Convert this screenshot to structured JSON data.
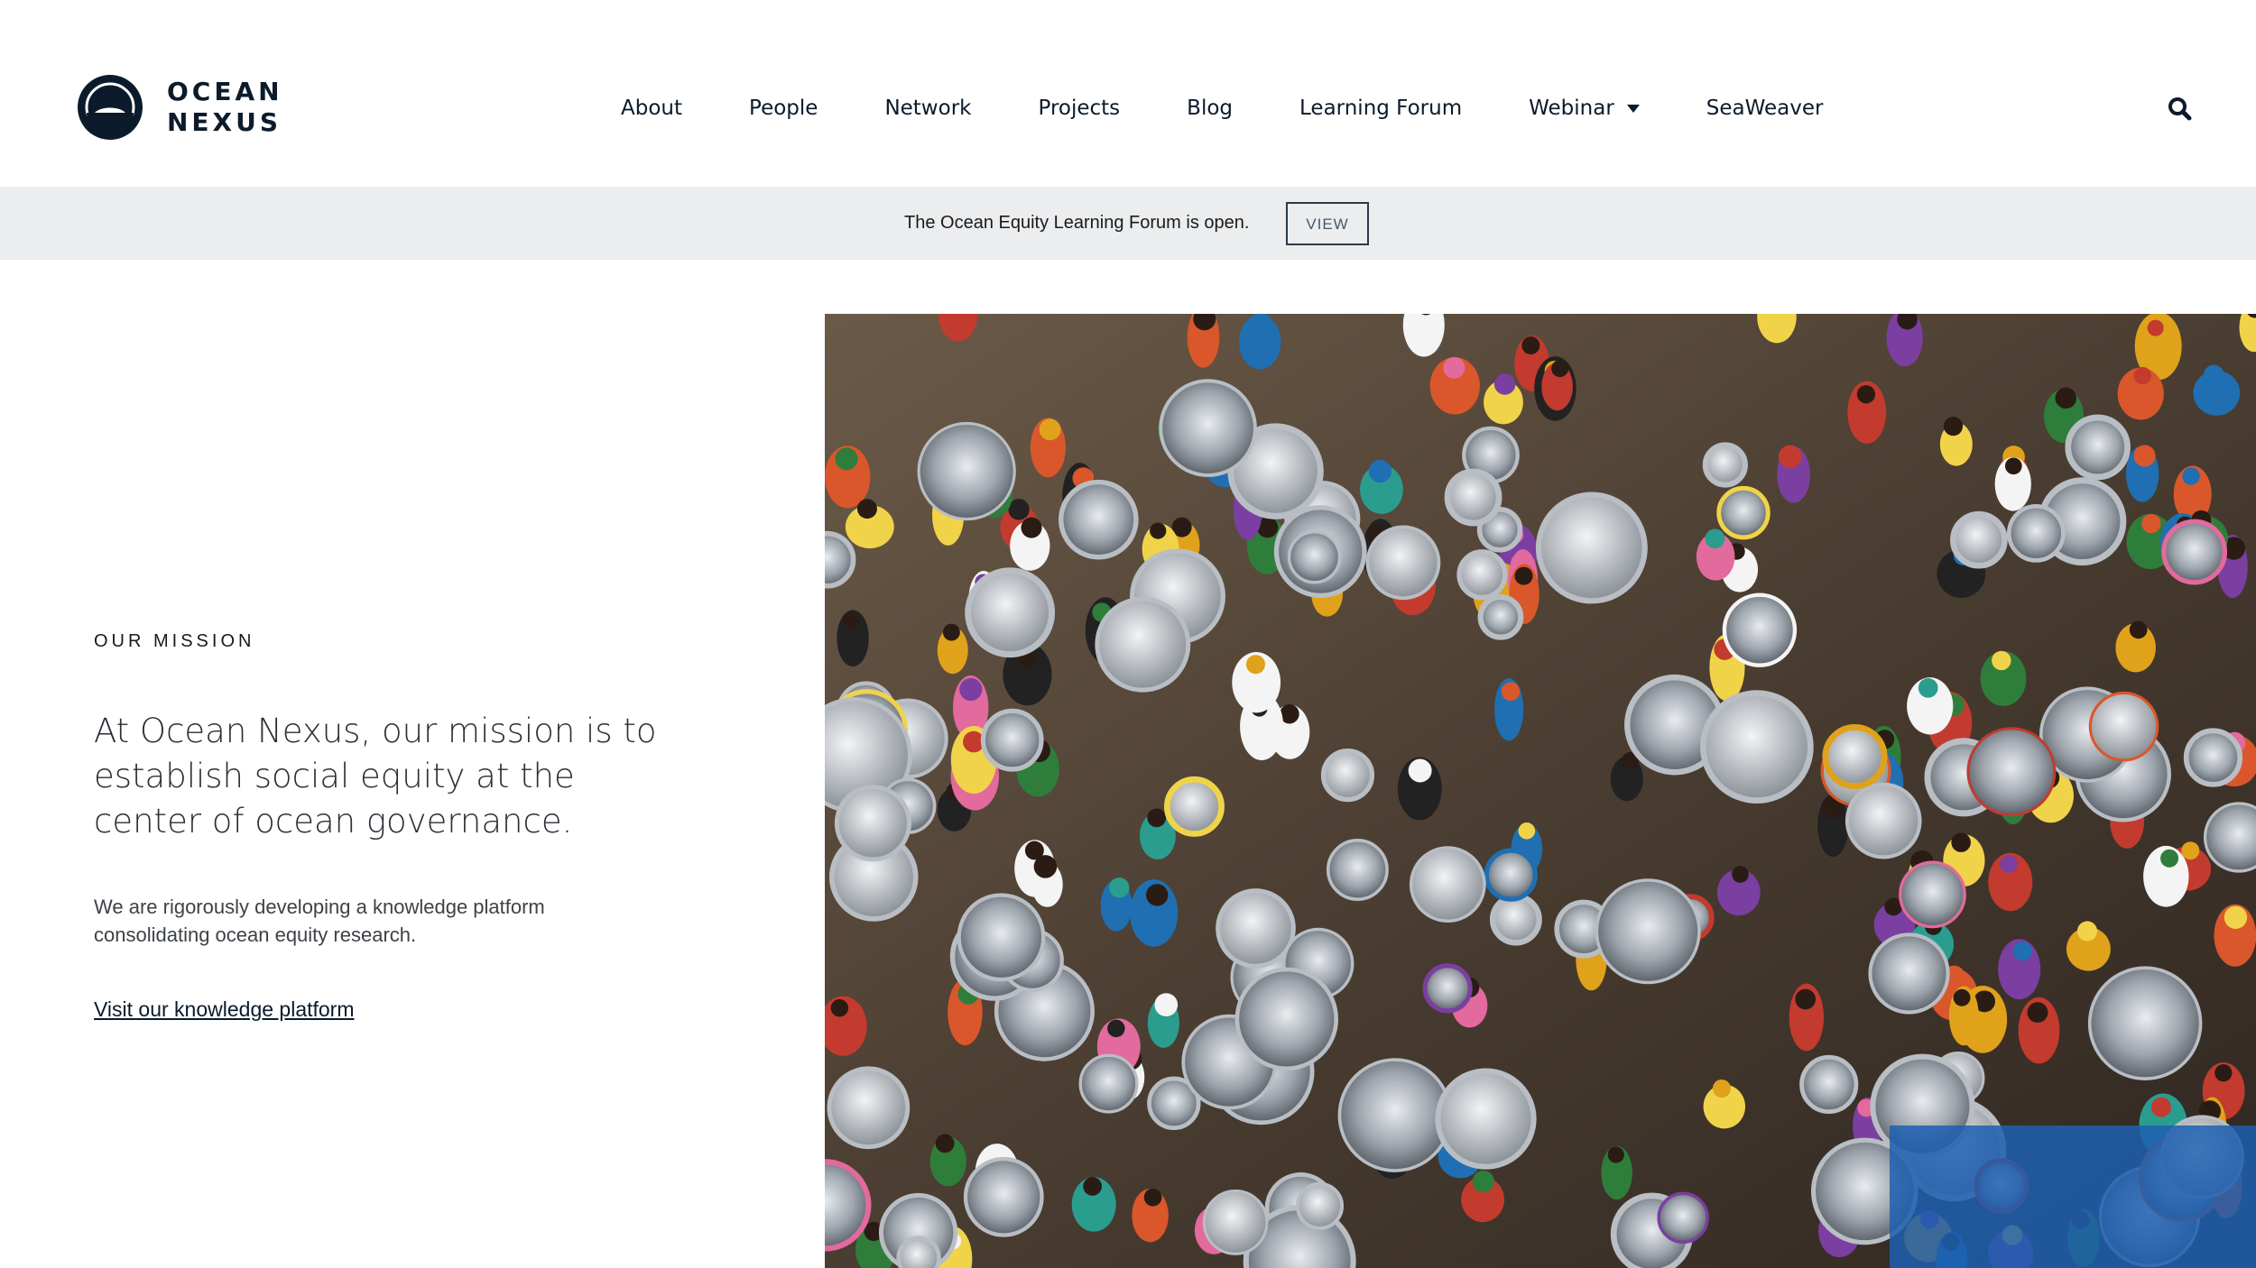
{
  "header": {
    "logo": {
      "line1": "OCEAN",
      "line2": "NEXUS"
    },
    "nav": [
      {
        "label": "About"
      },
      {
        "label": "People"
      },
      {
        "label": "Network"
      },
      {
        "label": "Projects"
      },
      {
        "label": "Blog"
      },
      {
        "label": "Learning Forum"
      },
      {
        "label": "Webinar",
        "has_dropdown": true
      },
      {
        "label": "SeaWeaver"
      }
    ],
    "search_icon": "search-icon"
  },
  "announcement": {
    "text": "The Ocean Equity Learning Forum is open.",
    "button_label": "VIEW"
  },
  "mission": {
    "eyebrow": "OUR MISSION",
    "heading": "At Ocean Nexus, our mission is to establish social equity at the center of ocean governance.",
    "body": "We are rigorously developing a knowledge platform consolidating ocean equity research.",
    "link_label": "Visit our knowledge platform"
  },
  "hero_image": {
    "subject": "market-photo"
  },
  "colors": {
    "text_dark": "#0b1b2b",
    "announcement_bg": "#ebedef",
    "page_bg": "#ffffff"
  }
}
